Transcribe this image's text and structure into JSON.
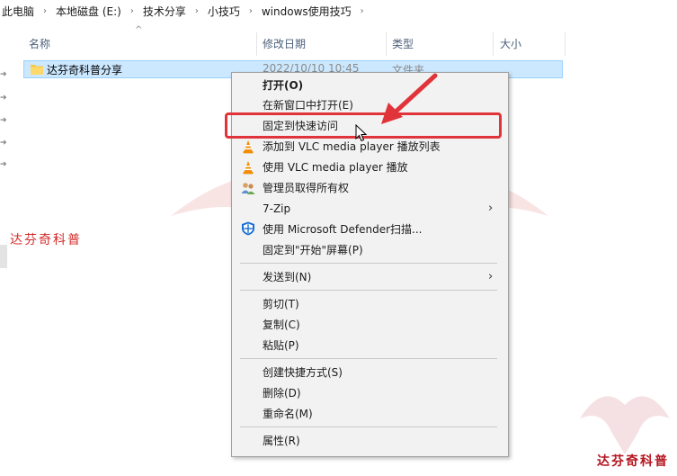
{
  "breadcrumb": [
    "此电脑",
    "本地磁盘 (E:)",
    "技术分享",
    "小技巧",
    "windows使用技巧"
  ],
  "breadcrumb_sep": "›",
  "columns": {
    "name": "名称",
    "date": "修改日期",
    "type": "类型",
    "size": "大小"
  },
  "sort_indicator": "^",
  "file": {
    "name": "达芬奇科普分享",
    "date": "2022/10/10 10:45",
    "type": "文件夹"
  },
  "watermark": {
    "left": "达芬奇科普",
    "right": "达芬奇科普"
  },
  "pin_glyph": "➔",
  "submenu_glyph": "›",
  "menu": {
    "open": "打开(O)",
    "open_new_window": "在新窗口中打开(E)",
    "pin_quick_access": "固定到快速访问",
    "vlc_add_playlist": "添加到 VLC media player 播放列表",
    "vlc_play": "使用 VLC media player 播放",
    "take_ownership": "管理员取得所有权",
    "seven_zip": "7-Zip",
    "defender_scan": "使用 Microsoft Defender扫描...",
    "pin_start": "固定到\"开始\"屏幕(P)",
    "send_to": "发送到(N)",
    "cut": "剪切(T)",
    "copy": "复制(C)",
    "paste": "粘贴(P)",
    "create_shortcut": "创建快捷方式(S)",
    "delete": "删除(D)",
    "rename": "重命名(M)",
    "properties": "属性(R)"
  },
  "colors": {
    "selection": "#cce8ff",
    "annotation_red": "#e0343a",
    "vlc_orange": "#f28c00",
    "defender_blue": "#1a6fd1"
  },
  "icons": [
    "folder-icon",
    "vlc-icon",
    "admin-users-icon",
    "defender-shield-icon",
    "annotation-arrow",
    "mouse-cursor-icon"
  ]
}
